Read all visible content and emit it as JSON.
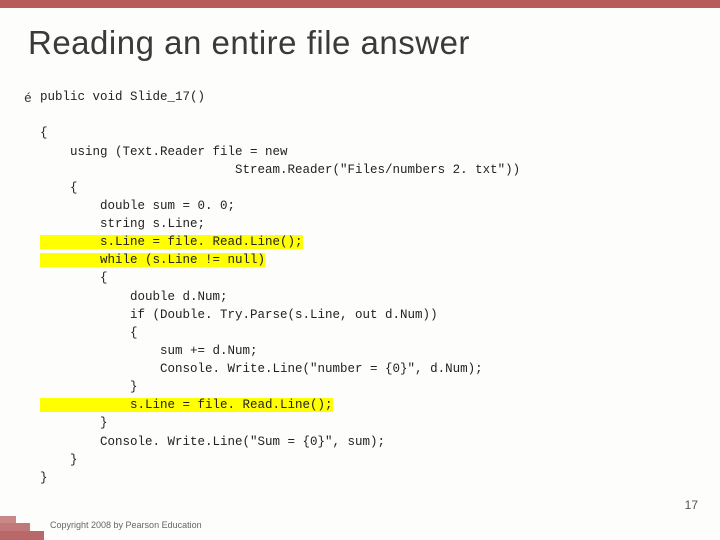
{
  "title": "Reading an entire file answer",
  "code": {
    "l1": "public void Slide_17()",
    "l2": "{",
    "l3": "    using (Text.Reader file = new",
    "l4": "                          Stream.Reader(\"Files/numbers 2. txt\"))",
    "l5": "    {",
    "l6": "        double sum = 0. 0;",
    "l7": "        string s.Line;",
    "l8": "        s.Line = file. Read.Line();",
    "l9": "        while (s.Line != null)",
    "l10": "        {",
    "l11": "            double d.Num;",
    "l12": "            if (Double. Try.Parse(s.Line, out d.Num))",
    "l13": "            {",
    "l14": "                sum += d.Num;",
    "l15": "                Console. Write.Line(\"number = {0}\", d.Num);",
    "l16": "            }",
    "l17": "            s.Line = file. Read.Line();",
    "l18": "        }",
    "l19": "        Console. Write.Line(\"Sum = {0}\", sum);",
    "l20": "    }",
    "l21": "}"
  },
  "footer": "Copyright 2008 by Pearson Education",
  "pageNumber": "17"
}
